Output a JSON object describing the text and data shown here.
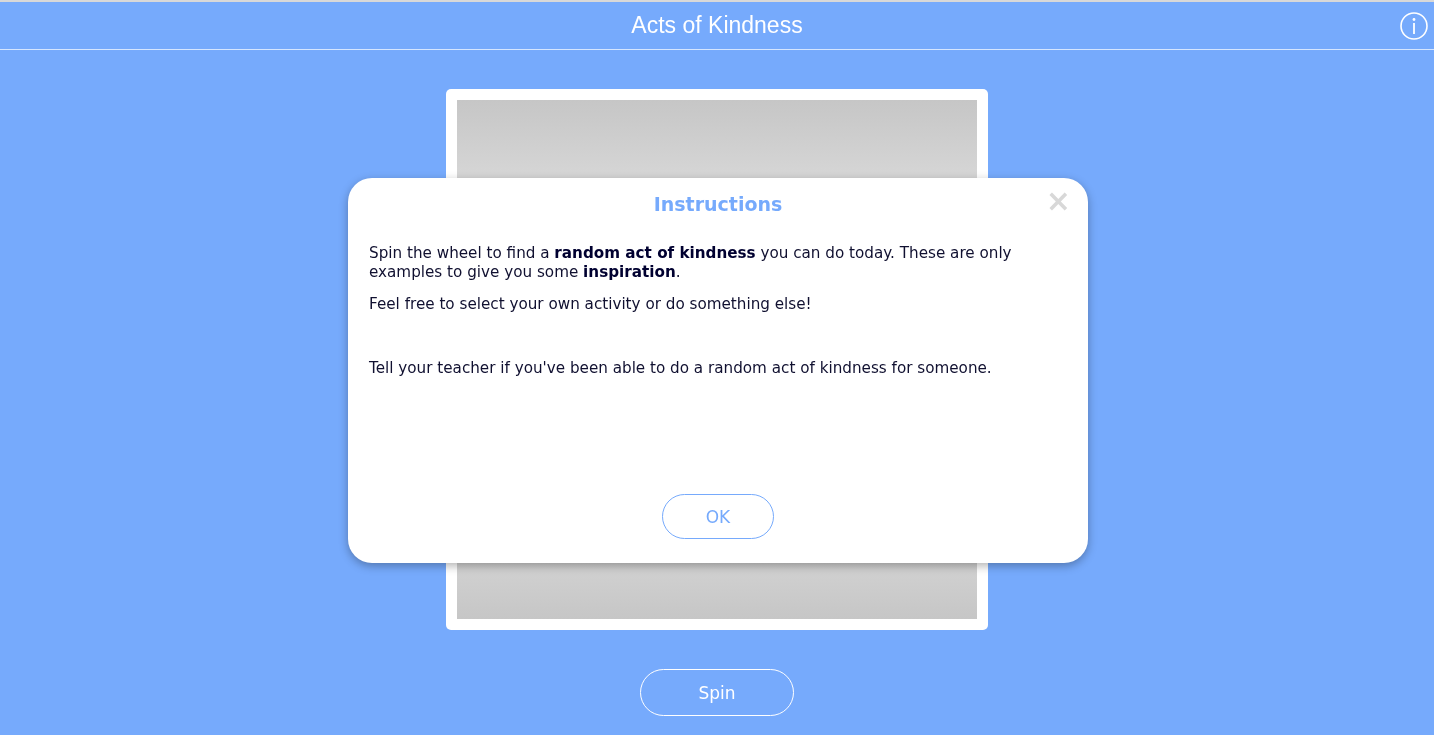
{
  "header": {
    "title": "Acts of Kindness"
  },
  "spin_button": "Spin",
  "dialog": {
    "title": "Instructions",
    "close": "×",
    "paragraphs": [
      "Spin the wheel to find a **random act of kindness** you can do today. These are only examples to give you some **inspiration**.",
      "Feel free to select your own activity or do something else!",
      "Tell your teacher if you've been able to do a random act of kindness for someone."
    ],
    "ok_button": "OK"
  }
}
